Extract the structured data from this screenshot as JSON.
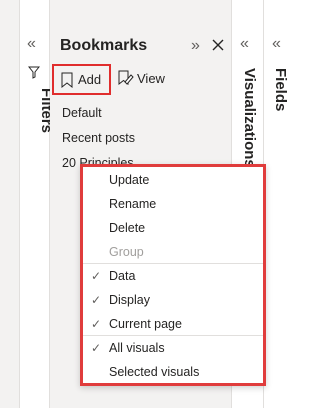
{
  "filters": {
    "label": "Filters"
  },
  "bookmarks": {
    "title": "Bookmarks",
    "add_label": "Add",
    "view_label": "View",
    "items": [
      "Default",
      "Recent posts",
      "20 Principles"
    ]
  },
  "visualizations": {
    "label": "Visualizations"
  },
  "fields": {
    "label": "Fields"
  },
  "context_menu": {
    "actions": [
      "Update",
      "Rename",
      "Delete",
      "Group"
    ],
    "options": [
      "Data",
      "Display",
      "Current page"
    ],
    "scope": [
      "All visuals",
      "Selected visuals"
    ]
  },
  "colors": {
    "highlight": "#e02d2d",
    "pane_bg": "#f3f2f1"
  },
  "icons": [
    "double-chevron-left-icon",
    "funnel-icon",
    "double-chevron-right-icon",
    "close-icon",
    "bookmark-add-icon",
    "bookmark-view-icon",
    "check-icon"
  ]
}
